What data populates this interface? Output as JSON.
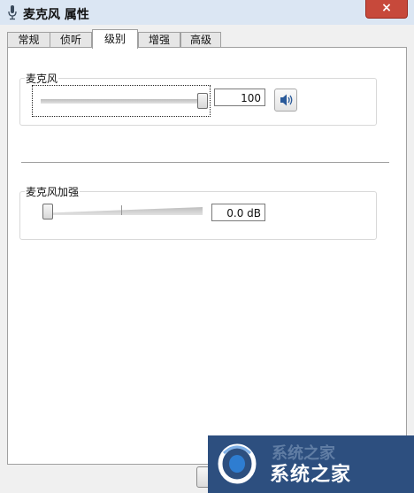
{
  "window": {
    "title": "麦克风 属性",
    "close_label": "×"
  },
  "tabs": [
    {
      "label": "常规"
    },
    {
      "label": "侦听"
    },
    {
      "label": "级别"
    },
    {
      "label": "增强"
    },
    {
      "label": "高级"
    }
  ],
  "active_tab": "级别",
  "microphone": {
    "label": "麦克风",
    "value": "100",
    "level_fraction": 1.0,
    "speaker_icon": "speaker-icon"
  },
  "boost": {
    "label": "麦克风加强",
    "value": "0.0 dB",
    "level_fraction": 0.0
  },
  "watermark": {
    "text_top": "系统之家",
    "text": "系统之家"
  }
}
